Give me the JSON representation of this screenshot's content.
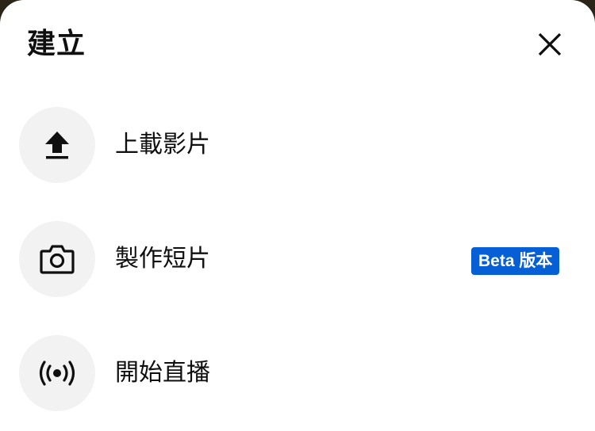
{
  "sheet": {
    "title": "建立",
    "close_icon": "close-icon"
  },
  "items": [
    {
      "label": "上載影片",
      "icon": "upload-icon"
    },
    {
      "label": "製作短片",
      "icon": "camera-icon",
      "badge": "Beta 版本"
    },
    {
      "label": "開始直播",
      "icon": "live-broadcast-icon"
    }
  ],
  "colors": {
    "badge": "#065fd4",
    "icon_circle": "#f2f2f2",
    "text": "#0f0f0f"
  }
}
